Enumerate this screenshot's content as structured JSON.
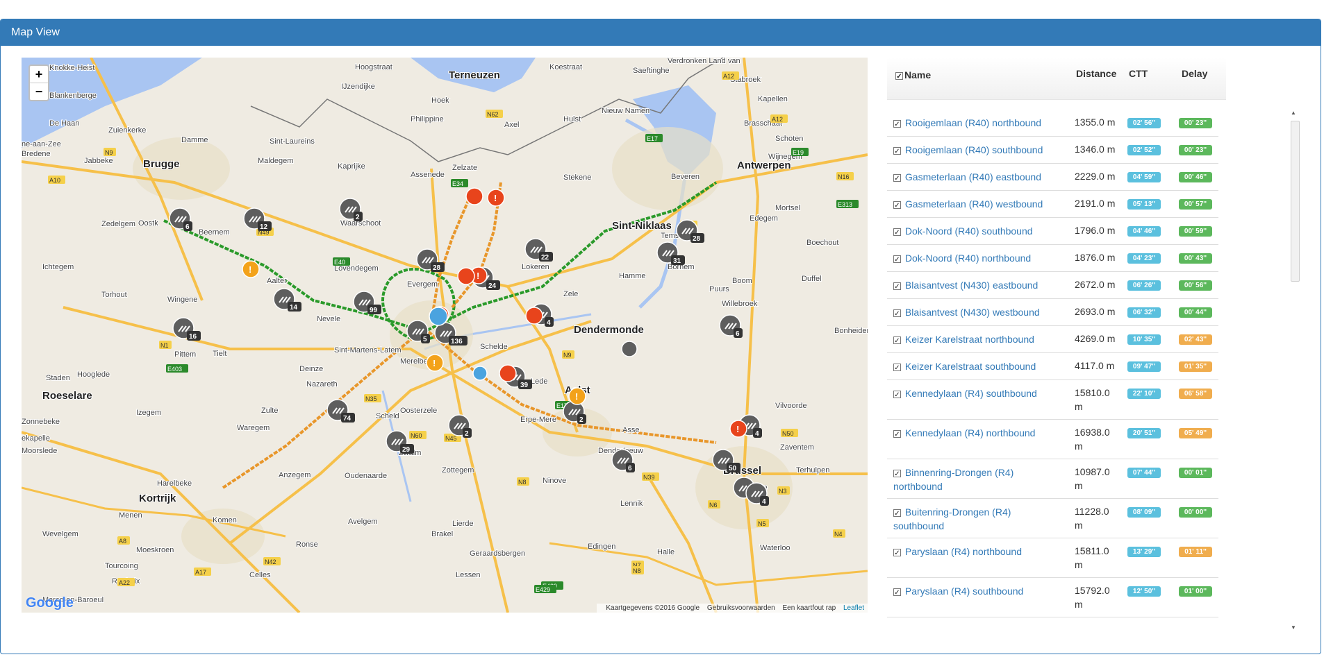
{
  "panel": {
    "title": "Map View"
  },
  "map": {
    "zoom_in": "+",
    "zoom_out": "−",
    "google": "Google",
    "attribution": [
      "Kaartgegevens ©2016 Google",
      "Gebruiksvoorwaarden",
      "Een kaartfout rap"
    ],
    "leaflet": "Leaflet",
    "labels": [
      {
        "t": "Knokke-Heist"
      },
      {
        "t": "Blankenberge"
      },
      {
        "t": "De Haan"
      },
      {
        "t": "Zuienkerke"
      },
      {
        "t": "ne-aan-Zee"
      },
      {
        "t": "Bredene"
      },
      {
        "t": "Jabbeke"
      },
      {
        "t": "Brugge"
      },
      {
        "t": "Damme"
      },
      {
        "t": "Maldegem"
      },
      {
        "t": "Sint-Laureins"
      },
      {
        "t": "IJzendijke"
      },
      {
        "t": "Terneuzen"
      },
      {
        "t": "Hoek"
      },
      {
        "t": "Philippine"
      },
      {
        "t": "Axel"
      },
      {
        "t": "Hulst"
      },
      {
        "t": "Nieuw Namen"
      },
      {
        "t": "Stabroek"
      },
      {
        "t": "Kapellen"
      },
      {
        "t": "Brasschaat"
      },
      {
        "t": "Schoten"
      },
      {
        "t": "Wijnegem"
      },
      {
        "t": "Antwerpen"
      },
      {
        "t": "Mortsel"
      },
      {
        "t": "Edegem"
      },
      {
        "t": "Beveren"
      },
      {
        "t": "Stekene"
      },
      {
        "t": "Zelzate"
      },
      {
        "t": "Assenede"
      },
      {
        "t": "Kaprijke"
      },
      {
        "t": "Waarschoot"
      },
      {
        "t": "Zedelgem"
      },
      {
        "t": "Oostk"
      },
      {
        "t": "Beernem"
      },
      {
        "t": "Ichtegem"
      },
      {
        "t": "Aalter"
      },
      {
        "t": "Torhout"
      },
      {
        "t": "Wingene"
      },
      {
        "t": "Lovendegem"
      },
      {
        "t": "Evergem"
      },
      {
        "t": "Nevele"
      },
      {
        "t": "Lokeren"
      },
      {
        "t": "Sint-Niklaas"
      },
      {
        "t": "Temse"
      },
      {
        "t": "Bornem"
      },
      {
        "t": "Hamme"
      },
      {
        "t": "Puurs"
      },
      {
        "t": "Boom"
      },
      {
        "t": "Willebroek"
      },
      {
        "t": "Duffel"
      },
      {
        "t": "Zele"
      },
      {
        "t": "Dendermonde"
      },
      {
        "t": "Pittem"
      },
      {
        "t": "Tielt"
      },
      {
        "t": "Deinze"
      },
      {
        "t": "Sint-Martens-Latem"
      },
      {
        "t": "Merelbeke"
      },
      {
        "t": "Staden"
      },
      {
        "t": "Hooglede"
      },
      {
        "t": "Roeselare"
      },
      {
        "t": "Izegem"
      },
      {
        "t": "Zulte"
      },
      {
        "t": "Nazareth"
      },
      {
        "t": "Oosterzele"
      },
      {
        "t": "Lede"
      },
      {
        "t": "Aalst"
      },
      {
        "t": "Erpe-Mere"
      },
      {
        "t": "Asse"
      },
      {
        "t": "Denderleeuw"
      },
      {
        "t": "Zaventem"
      },
      {
        "t": "Brussel"
      },
      {
        "t": "Elsene"
      },
      {
        "t": "Terhulpen"
      },
      {
        "t": "Waterloo"
      },
      {
        "t": "Halle"
      },
      {
        "t": "Lennik"
      },
      {
        "t": "Ninove"
      },
      {
        "t": "Zottegem"
      },
      {
        "t": "Zwalm"
      },
      {
        "t": "Waregem"
      },
      {
        "t": "Moorslede"
      },
      {
        "t": "ekapelle"
      },
      {
        "t": "Zonnebeke"
      },
      {
        "t": "Harelbeke"
      },
      {
        "t": "Kortrijk"
      },
      {
        "t": "Anzegem"
      },
      {
        "t": "Oudenaarde"
      },
      {
        "t": "Menen"
      },
      {
        "t": "Wevelgem"
      },
      {
        "t": "Komen"
      },
      {
        "t": "Avelgem"
      },
      {
        "t": "Ronse"
      },
      {
        "t": "Brakel"
      },
      {
        "t": "Lierde"
      },
      {
        "t": "Geraardsbergen"
      },
      {
        "t": "Moeskroen"
      },
      {
        "t": "Tourcoing"
      },
      {
        "t": "Roubaix"
      },
      {
        "t": "Celles"
      },
      {
        "t": "Lessen"
      },
      {
        "t": "Edingen"
      },
      {
        "t": "Boechout"
      },
      {
        "t": "Bonheiden"
      },
      {
        "t": "Vilvoorde"
      },
      {
        "t": "Schelde"
      },
      {
        "t": "Scheld"
      },
      {
        "t": "Marco-en-Baroeul"
      },
      {
        "t": "Saeftinghe"
      },
      {
        "t": "Verdronken Land van"
      },
      {
        "t": "Hoogstraat"
      },
      {
        "t": "Koestraat"
      }
    ],
    "road_labels": [
      "E40",
      "E34",
      "E17",
      "A10",
      "N9",
      "N49",
      "N62",
      "E19",
      "A12",
      "N70",
      "N16",
      "E313",
      "A12",
      "N1",
      "E403",
      "N50",
      "N35",
      "N60",
      "N8",
      "N6",
      "N5",
      "N3",
      "N4",
      "E429",
      "A8",
      "A17",
      "N7",
      "N8",
      "E429",
      "N9",
      "N45",
      "N42",
      "N39",
      "A22",
      "E17"
    ],
    "markers": [
      {
        "n": "6"
      },
      {
        "n": "12"
      },
      {
        "n": "2"
      },
      {
        "n": "14"
      },
      {
        "n": "99"
      },
      {
        "n": "28"
      },
      {
        "n": "24"
      },
      {
        "n": "22"
      },
      {
        "n": "28"
      },
      {
        "n": "31"
      },
      {
        "n": "16"
      },
      {
        "n": "5"
      },
      {
        "n": "136"
      },
      {
        "n": "4"
      },
      {
        "n": "6"
      },
      {
        "n": "39"
      },
      {
        "n": "74"
      },
      {
        "n": "29"
      },
      {
        "n": "2"
      },
      {
        "n": "2"
      },
      {
        "n": "6"
      },
      {
        "n": "50"
      },
      {
        "n": "5"
      },
      {
        "n": "4"
      },
      {
        "n": "4"
      }
    ]
  },
  "list": {
    "headers": {
      "name": "Name",
      "distance": "Distance",
      "ctt": "CTT",
      "delay": "Delay"
    },
    "check": "✓",
    "rows": [
      {
        "name": "Rooigemlaan (R40) northbound",
        "distance": "1355.0 m",
        "ctt": "02' 56''",
        "delay": "00' 23''",
        "color": "green"
      },
      {
        "name": "Rooigemlaan (R40) southbound",
        "distance": "1346.0 m",
        "ctt": "02' 52''",
        "delay": "00' 23''",
        "color": "green"
      },
      {
        "name": "Gasmeterlaan (R40) eastbound",
        "distance": "2229.0 m",
        "ctt": "04' 59''",
        "delay": "00' 46''",
        "color": "green"
      },
      {
        "name": "Gasmeterlaan (R40) westbound",
        "distance": "2191.0 m",
        "ctt": "05' 13''",
        "delay": "00' 57''",
        "color": "green"
      },
      {
        "name": "Dok-Noord (R40) southbound",
        "distance": "1796.0 m",
        "ctt": "04' 46''",
        "delay": "00' 59''",
        "color": "green"
      },
      {
        "name": "Dok-Noord (R40) northbound",
        "distance": "1876.0 m",
        "ctt": "04' 23''",
        "delay": "00' 43''",
        "color": "green"
      },
      {
        "name": "Blaisantvest (N430) eastbound",
        "distance": "2672.0 m",
        "ctt": "06' 26''",
        "delay": "00' 56''",
        "color": "green"
      },
      {
        "name": "Blaisantvest (N430) westbound",
        "distance": "2693.0 m",
        "ctt": "06' 32''",
        "delay": "00' 44''",
        "color": "green"
      },
      {
        "name": "Keizer Karelstraat northbound",
        "distance": "4269.0 m",
        "ctt": "10' 35''",
        "delay": "02' 43''",
        "color": "orange"
      },
      {
        "name": "Keizer Karelstraat southbound",
        "distance": "4117.0 m",
        "ctt": "09' 47''",
        "delay": "01' 35''",
        "color": "orange"
      },
      {
        "name": "Kennedylaan (R4) southbound",
        "distance": "15810.0 m",
        "ctt": "22' 10''",
        "delay": "06' 58''",
        "color": "orange"
      },
      {
        "name": "Kennedylaan (R4) northbound",
        "distance": "16938.0 m",
        "ctt": "20' 51''",
        "delay": "05' 49''",
        "color": "orange"
      },
      {
        "name": "Binnenring-Drongen (R4) northbound",
        "distance": "10987.0 m",
        "ctt": "07' 44''",
        "delay": "00' 01''",
        "color": "green"
      },
      {
        "name": "Buitenring-Drongen (R4) southbound",
        "distance": "11228.0 m",
        "ctt": "08' 09''",
        "delay": "00' 00''",
        "color": "green"
      },
      {
        "name": "Paryslaan (R4) northbound",
        "distance": "15811.0 m",
        "ctt": "13' 29''",
        "delay": "01' 11''",
        "color": "orange"
      },
      {
        "name": "Paryslaan (R4) southbound",
        "distance": "15792.0 m",
        "ctt": "12' 50''",
        "delay": "01' 00''",
        "color": "green"
      }
    ]
  },
  "colors": {
    "header": "#337ab7",
    "ctt": "#5bc0de",
    "delay_ok": "#5cb85c",
    "delay_warn": "#f0ad4e",
    "route_green": "#2a9a2a",
    "route_orange": "#e8962a"
  }
}
